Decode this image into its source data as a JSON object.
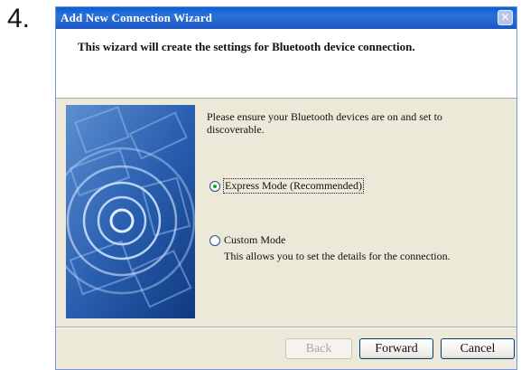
{
  "step_number": "4.",
  "window": {
    "title": "Add New Connection Wizard",
    "close_glyph": "✕"
  },
  "header": {
    "text": "This wizard will create the settings for Bluetooth device connection."
  },
  "content": {
    "instruction": "Please ensure your Bluetooth devices are on and set to discoverable.",
    "options": [
      {
        "label": "Express Mode (Recommended)",
        "selected": true,
        "description": ""
      },
      {
        "label": "Custom Mode",
        "selected": false,
        "description": "This allows you to set the details for the connection."
      }
    ]
  },
  "buttons": {
    "back": "Back",
    "forward": "Forward",
    "cancel": "Cancel"
  },
  "colors": {
    "titlebar": "#1d56c4",
    "dialog": "#ece9d8",
    "banner": "#1e5aa8"
  },
  "icons": {
    "close": "close-icon",
    "banner": "bluetooth-signal-illustration"
  }
}
